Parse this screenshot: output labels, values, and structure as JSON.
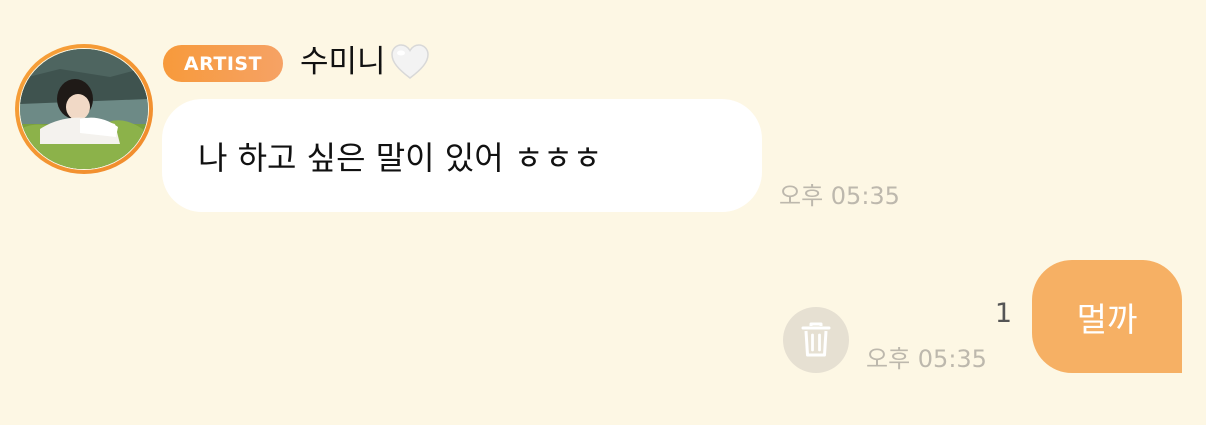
{
  "colors": {
    "background": "#fdf7e4",
    "accent_orange": "#f79a3b",
    "sent_bubble": "#f6b064",
    "received_bubble": "#ffffff",
    "timestamp": "#bdb8ad"
  },
  "received_message": {
    "badge": "ARTIST",
    "sender_name": "수미니",
    "sender_name_emoji": "white-heart-icon",
    "avatar": "avatar-photo",
    "text": "나 하고 싶은 말이 있어 ㅎㅎㅎ",
    "time": "오후 05:35"
  },
  "sent_message": {
    "text": "멀까",
    "time": "오후 05:35",
    "unread_count": "1",
    "delete_icon": "trash-icon"
  }
}
